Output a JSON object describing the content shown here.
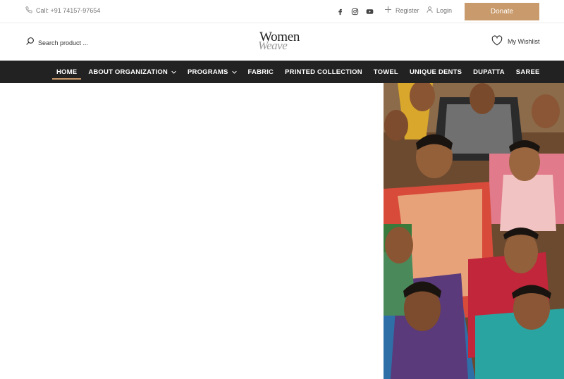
{
  "topbar": {
    "call_text": "Call: +91 74157-97654",
    "register_label": "Register",
    "login_label": "Login",
    "donate_label": "Donate",
    "socials": [
      "facebook-icon",
      "instagram-icon",
      "youtube-icon"
    ]
  },
  "header": {
    "search_placeholder": "Search product ...",
    "logo_line1": "Women",
    "logo_line2": "Weave",
    "wishlist_label": "My Wishlist"
  },
  "nav": {
    "items": [
      {
        "label": "HOME",
        "active": true
      },
      {
        "label": "ABOUT ORGANIZATION",
        "dropdown": true
      },
      {
        "label": "PROGRAMS",
        "dropdown": true
      },
      {
        "label": "FABRIC"
      },
      {
        "label": "PRINTED COLLECTION"
      },
      {
        "label": "TOWEL"
      },
      {
        "label": "UNIQUE DENTS"
      },
      {
        "label": "DUPATTA"
      },
      {
        "label": "SAREE"
      }
    ]
  },
  "colors": {
    "accent": "#c99a6b",
    "nav_bg": "#222222"
  }
}
